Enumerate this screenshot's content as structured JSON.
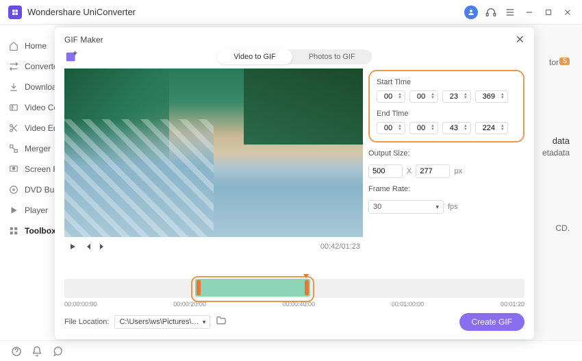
{
  "app": {
    "title": "Wondershare UniConverter"
  },
  "sidebar": {
    "items": [
      {
        "label": "Home"
      },
      {
        "label": "Converter"
      },
      {
        "label": "Downloader"
      },
      {
        "label": "Video Compressor"
      },
      {
        "label": "Video Editor"
      },
      {
        "label": "Merger"
      },
      {
        "label": "Screen Recorder"
      },
      {
        "label": "DVD Burner"
      },
      {
        "label": "Player"
      },
      {
        "label": "Toolbox"
      }
    ]
  },
  "bg": {
    "tor_suffix": "tor",
    "s_badge": "S",
    "data_txt": "data",
    "etadata_txt": "etadata",
    "cd_txt": "CD."
  },
  "gif": {
    "title": "GIF Maker",
    "tabs": {
      "video": "Video to GIF",
      "photos": "Photos to GIF"
    },
    "time": {
      "start_label": "Start Time",
      "end_label": "End Time",
      "start": {
        "hh": "00",
        "mm": "00",
        "ss": "23",
        "ms": "369"
      },
      "end": {
        "hh": "00",
        "mm": "00",
        "ss": "43",
        "ms": "224"
      }
    },
    "output": {
      "label": "Output Size:",
      "w": "500",
      "x": "X",
      "h": "277",
      "unit": "px"
    },
    "fps": {
      "label": "Frame Rate:",
      "value": "30",
      "unit": "fps"
    },
    "playback": {
      "time": "00:42/01:23"
    },
    "ruler": [
      "00:00:00:00",
      "00:00:20:00",
      "00:00:40:00",
      "00:01:00:00",
      "00:01:20"
    ],
    "file": {
      "label": "File Location:",
      "path": "C:\\Users\\ws\\Pictures\\Wonders"
    },
    "create": "Create GIF"
  }
}
